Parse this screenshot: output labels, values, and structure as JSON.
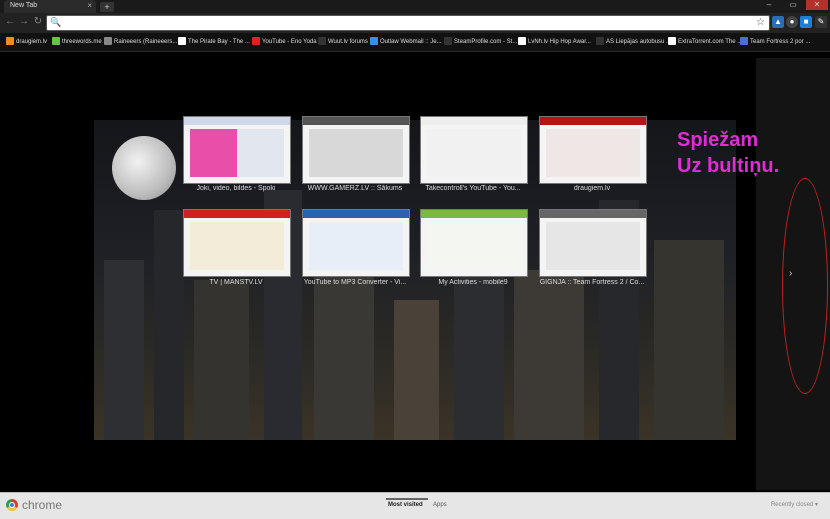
{
  "tab": {
    "title": "New Tab",
    "close": "×"
  },
  "window_controls": [
    "–",
    "▭",
    "✕"
  ],
  "toolbar": {
    "back": "←",
    "forward": "→",
    "reload": "↻",
    "omnibox_value": ""
  },
  "bookmarks": [
    {
      "label": "draugiem.lv",
      "color": "#f28c1f"
    },
    {
      "label": "threewords.me",
      "color": "#6cc04a"
    },
    {
      "label": "Raineeers (Raineeers...",
      "color": "#888888"
    },
    {
      "label": "The Pirate Bay - The ...",
      "color": "#ffffff"
    },
    {
      "label": "YouTube - Eno Yoda",
      "color": "#d22"
    },
    {
      "label": "Wuut.lv forums",
      "color": "#333333"
    },
    {
      "label": "Outlaw Webmail :: Je...",
      "color": "#3a8ee6"
    },
    {
      "label": "SteamProfile.com - St...",
      "color": "#333333"
    },
    {
      "label": "LvNh.lv Hip Hop Awar...",
      "color": "#ffffff"
    },
    {
      "label": "AS Liepājas autobusu ...",
      "color": "#333333"
    },
    {
      "label": "ExtraTorrent.com The ...",
      "color": "#ffffff"
    },
    {
      "label": "Team Fortress 2 por ...",
      "color": "#4a6fd1"
    }
  ],
  "thumbnails": [
    {
      "label": "Joki, video, bildes - Spoki",
      "accent": "#e94fa8"
    },
    {
      "label": "WWW.GAMERZ.LV :: Sākums",
      "accent": "#555555"
    },
    {
      "label": "Takecontroll's YouTube - You...",
      "accent": "#cc2222"
    },
    {
      "label": "draugiem.lv",
      "accent": "#b5121b"
    },
    {
      "label": "TV | MANSTV.LV",
      "accent": "#cc2222"
    },
    {
      "label": "YouTube to MP3 Converter - Vi...",
      "accent": "#2a62b0"
    },
    {
      "label": "My Activities - mobile9",
      "accent": "#78b844"
    },
    {
      "label": "GIGNJA :: Team Fortress 2 / Co...",
      "accent": "#666666"
    }
  ],
  "annotation": {
    "text": "Spiežam\nUz bultiņu."
  },
  "next_arrow": "›",
  "footer": {
    "brand": "chrome",
    "tabs": [
      "Most visited",
      "Apps"
    ],
    "recently_closed": "Recently closed ▾"
  }
}
